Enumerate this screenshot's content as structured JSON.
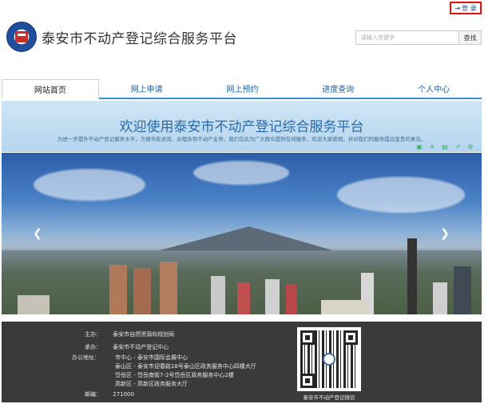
{
  "header": {
    "login_label": "登 录",
    "site_title": "泰安市不动产登记综合服务平台",
    "search_placeholder": "请输入关键字",
    "search_button": "查找"
  },
  "nav": {
    "items": [
      {
        "label": "网站首页",
        "active": true
      },
      {
        "label": "网上申请",
        "active": false
      },
      {
        "label": "网上预约",
        "active": false
      },
      {
        "label": "进度查询",
        "active": false
      },
      {
        "label": "个人中心",
        "active": false
      }
    ]
  },
  "welcome": {
    "title": "欢迎使用泰安市不动产登记综合服务平台",
    "subtitle": "为进一步提升不动产登记服务水平，方便市民咨询、办理各项不动产业务，我们在此为广大群众提供在线服务，欢迎大家使用，并对我们的服务提出宝贵的意见。",
    "tool_icons": [
      "doc-icon",
      "expand-icon",
      "save-icon",
      "share-icon",
      "settings-icon"
    ]
  },
  "carousel": {
    "prev_icon": "chevron-left-icon",
    "next_icon": "chevron-right-icon"
  },
  "footer": {
    "sponsor_label": "主办：",
    "sponsor": "泰安市自然资源和规划局",
    "organizer_label": "承办：",
    "organizer": "泰安市不动产登记中心",
    "address_label": "办公地址：",
    "addresses": [
      "市中心 - 泰安市国际会展中心",
      "泰山区 - 泰安市迎春路18号泰山区政务服务中心四楼大厅",
      "岱岳区 - 岱岳南街7-2号岱岳区政务服务中心2楼",
      "高新区 - 高新区政务服务大厅"
    ],
    "postcode_label": "邮编：",
    "postcode": "271000",
    "qr_caption": "泰安市不动产登记微信"
  },
  "colors": {
    "login_border": "#e01010",
    "nav_text": "#1e5fa8",
    "nav_underline": "#3b8fd6",
    "welcome_title": "#2a6aa8",
    "footer_bg": "#3a3a3a"
  }
}
